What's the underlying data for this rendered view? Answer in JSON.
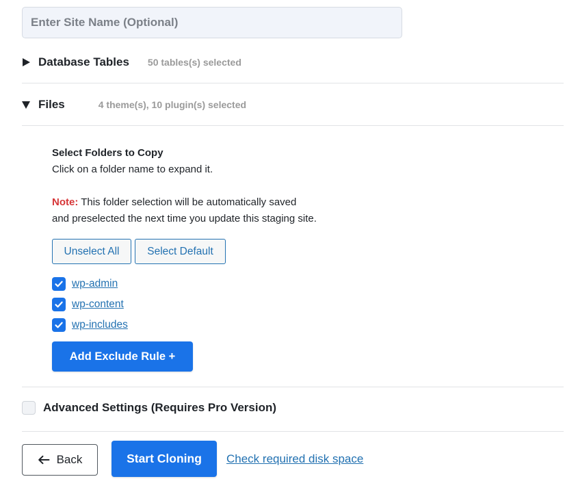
{
  "site_name": {
    "value": "",
    "placeholder": "Enter Site Name (Optional)"
  },
  "sections": {
    "database": {
      "title": "Database Tables",
      "meta": "50 tables(s) selected",
      "expanded": false
    },
    "files": {
      "title": "Files",
      "meta": "4 theme(s), 10 plugin(s) selected",
      "expanded": true
    }
  },
  "files_panel": {
    "heading": "Select Folders to Copy",
    "hint": "Click on a folder name to expand it.",
    "note_label": "Note:",
    "note_line1": " This folder selection will be automatically saved",
    "note_line2": "and preselected the next time you update this staging site.",
    "unselect_all_label": "Unselect All",
    "select_default_label": "Select Default",
    "folders": [
      {
        "name": "wp-admin",
        "checked": true
      },
      {
        "name": "wp-content",
        "checked": true
      },
      {
        "name": "wp-includes",
        "checked": true
      }
    ],
    "add_exclude_rule_label": "Add Exclude Rule +"
  },
  "advanced_settings": {
    "label": "Advanced Settings (Requires Pro Version)",
    "checked": false
  },
  "footer": {
    "back_label": "Back",
    "start_cloning_label": "Start Cloning",
    "disk_space_link": "Check required disk space"
  },
  "colors": {
    "primary": "#1a73e8",
    "link": "#2271b1",
    "note": "#d63638",
    "muted": "#9a9a9a"
  },
  "icons": {
    "database_toggle": "caret-right-icon",
    "files_toggle": "caret-down-icon",
    "back": "arrow-left-icon",
    "checkbox": "checkmark-icon"
  }
}
